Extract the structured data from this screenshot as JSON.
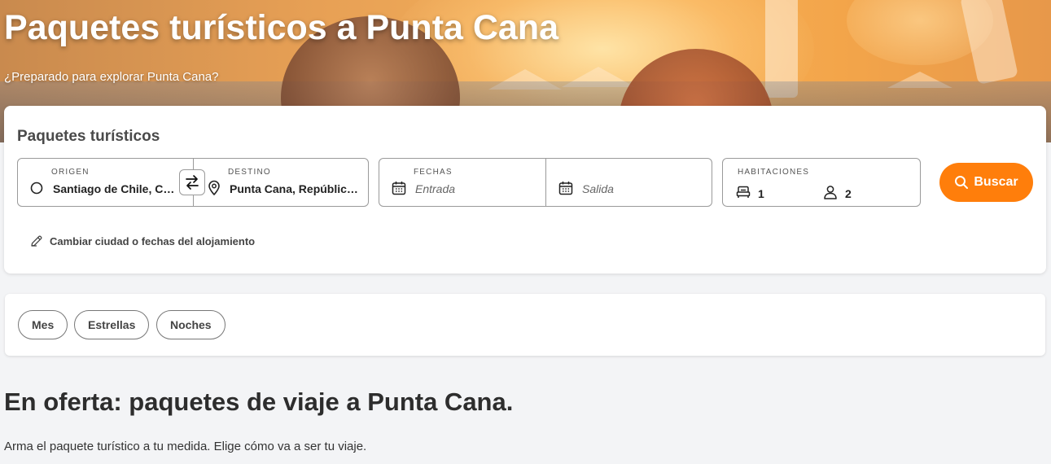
{
  "hero": {
    "title": "Paquetes turísticos a Punta Cana",
    "subtitle": "¿Preparado para explorar Punta Cana?"
  },
  "search": {
    "title": "Paquetes turísticos",
    "origin": {
      "label": "ORIGEN",
      "value": "Santiago de Chile, Ch…",
      "icon": "circle-icon"
    },
    "destination": {
      "label": "DESTINO",
      "value": "Punta Cana, Repúblic…",
      "icon": "location-pin-icon"
    },
    "dates": {
      "label": "FECHAS",
      "checkin_placeholder": "Entrada",
      "checkout_placeholder": "Salida",
      "icon": "calendar-icon"
    },
    "rooms": {
      "label": "HABITACIONES",
      "rooms_count": "1",
      "guests_count": "2",
      "icons": [
        "bed-icon",
        "person-icon"
      ]
    },
    "submit_label": "Buscar",
    "change_link": "Cambiar ciudad o fechas del alojamiento",
    "accent_color": "#ff7e0b"
  },
  "filters": {
    "chips": [
      "Mes",
      "Estrellas",
      "Noches"
    ]
  },
  "offers": {
    "title": "En oferta: paquetes de viaje a Punta Cana.",
    "subtitle": "Arma el paquete turístico a tu medida. Elige cómo va a ser tu viaje."
  }
}
